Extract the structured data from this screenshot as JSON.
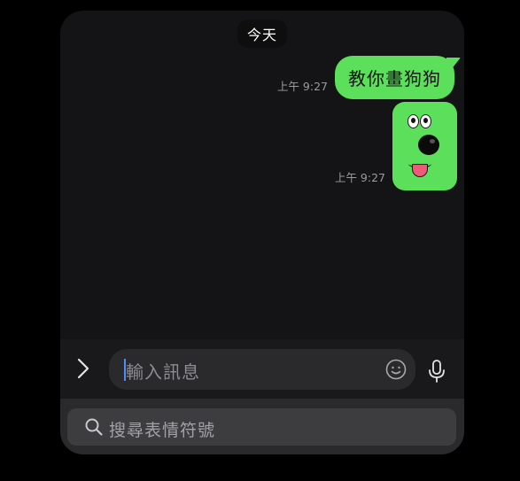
{
  "chat": {
    "date_label": "今天",
    "messages": [
      {
        "type": "text",
        "time": "上午 9:27",
        "text": "教你畫狗狗"
      },
      {
        "type": "sticker",
        "time": "上午 9:27",
        "sticker": "green-dog-face-sticker"
      }
    ]
  },
  "composer": {
    "expand_icon": "chevron-right-icon",
    "placeholder": "輸入訊息",
    "emoji_icon": "smiley-icon",
    "mic_icon": "microphone-icon"
  },
  "emoji_panel": {
    "search_placeholder": "搜尋表情符號",
    "search_icon": "search-icon"
  },
  "colors": {
    "bubble": "#5ce05c",
    "background": "#141315",
    "caret": "#4f8dfc"
  }
}
